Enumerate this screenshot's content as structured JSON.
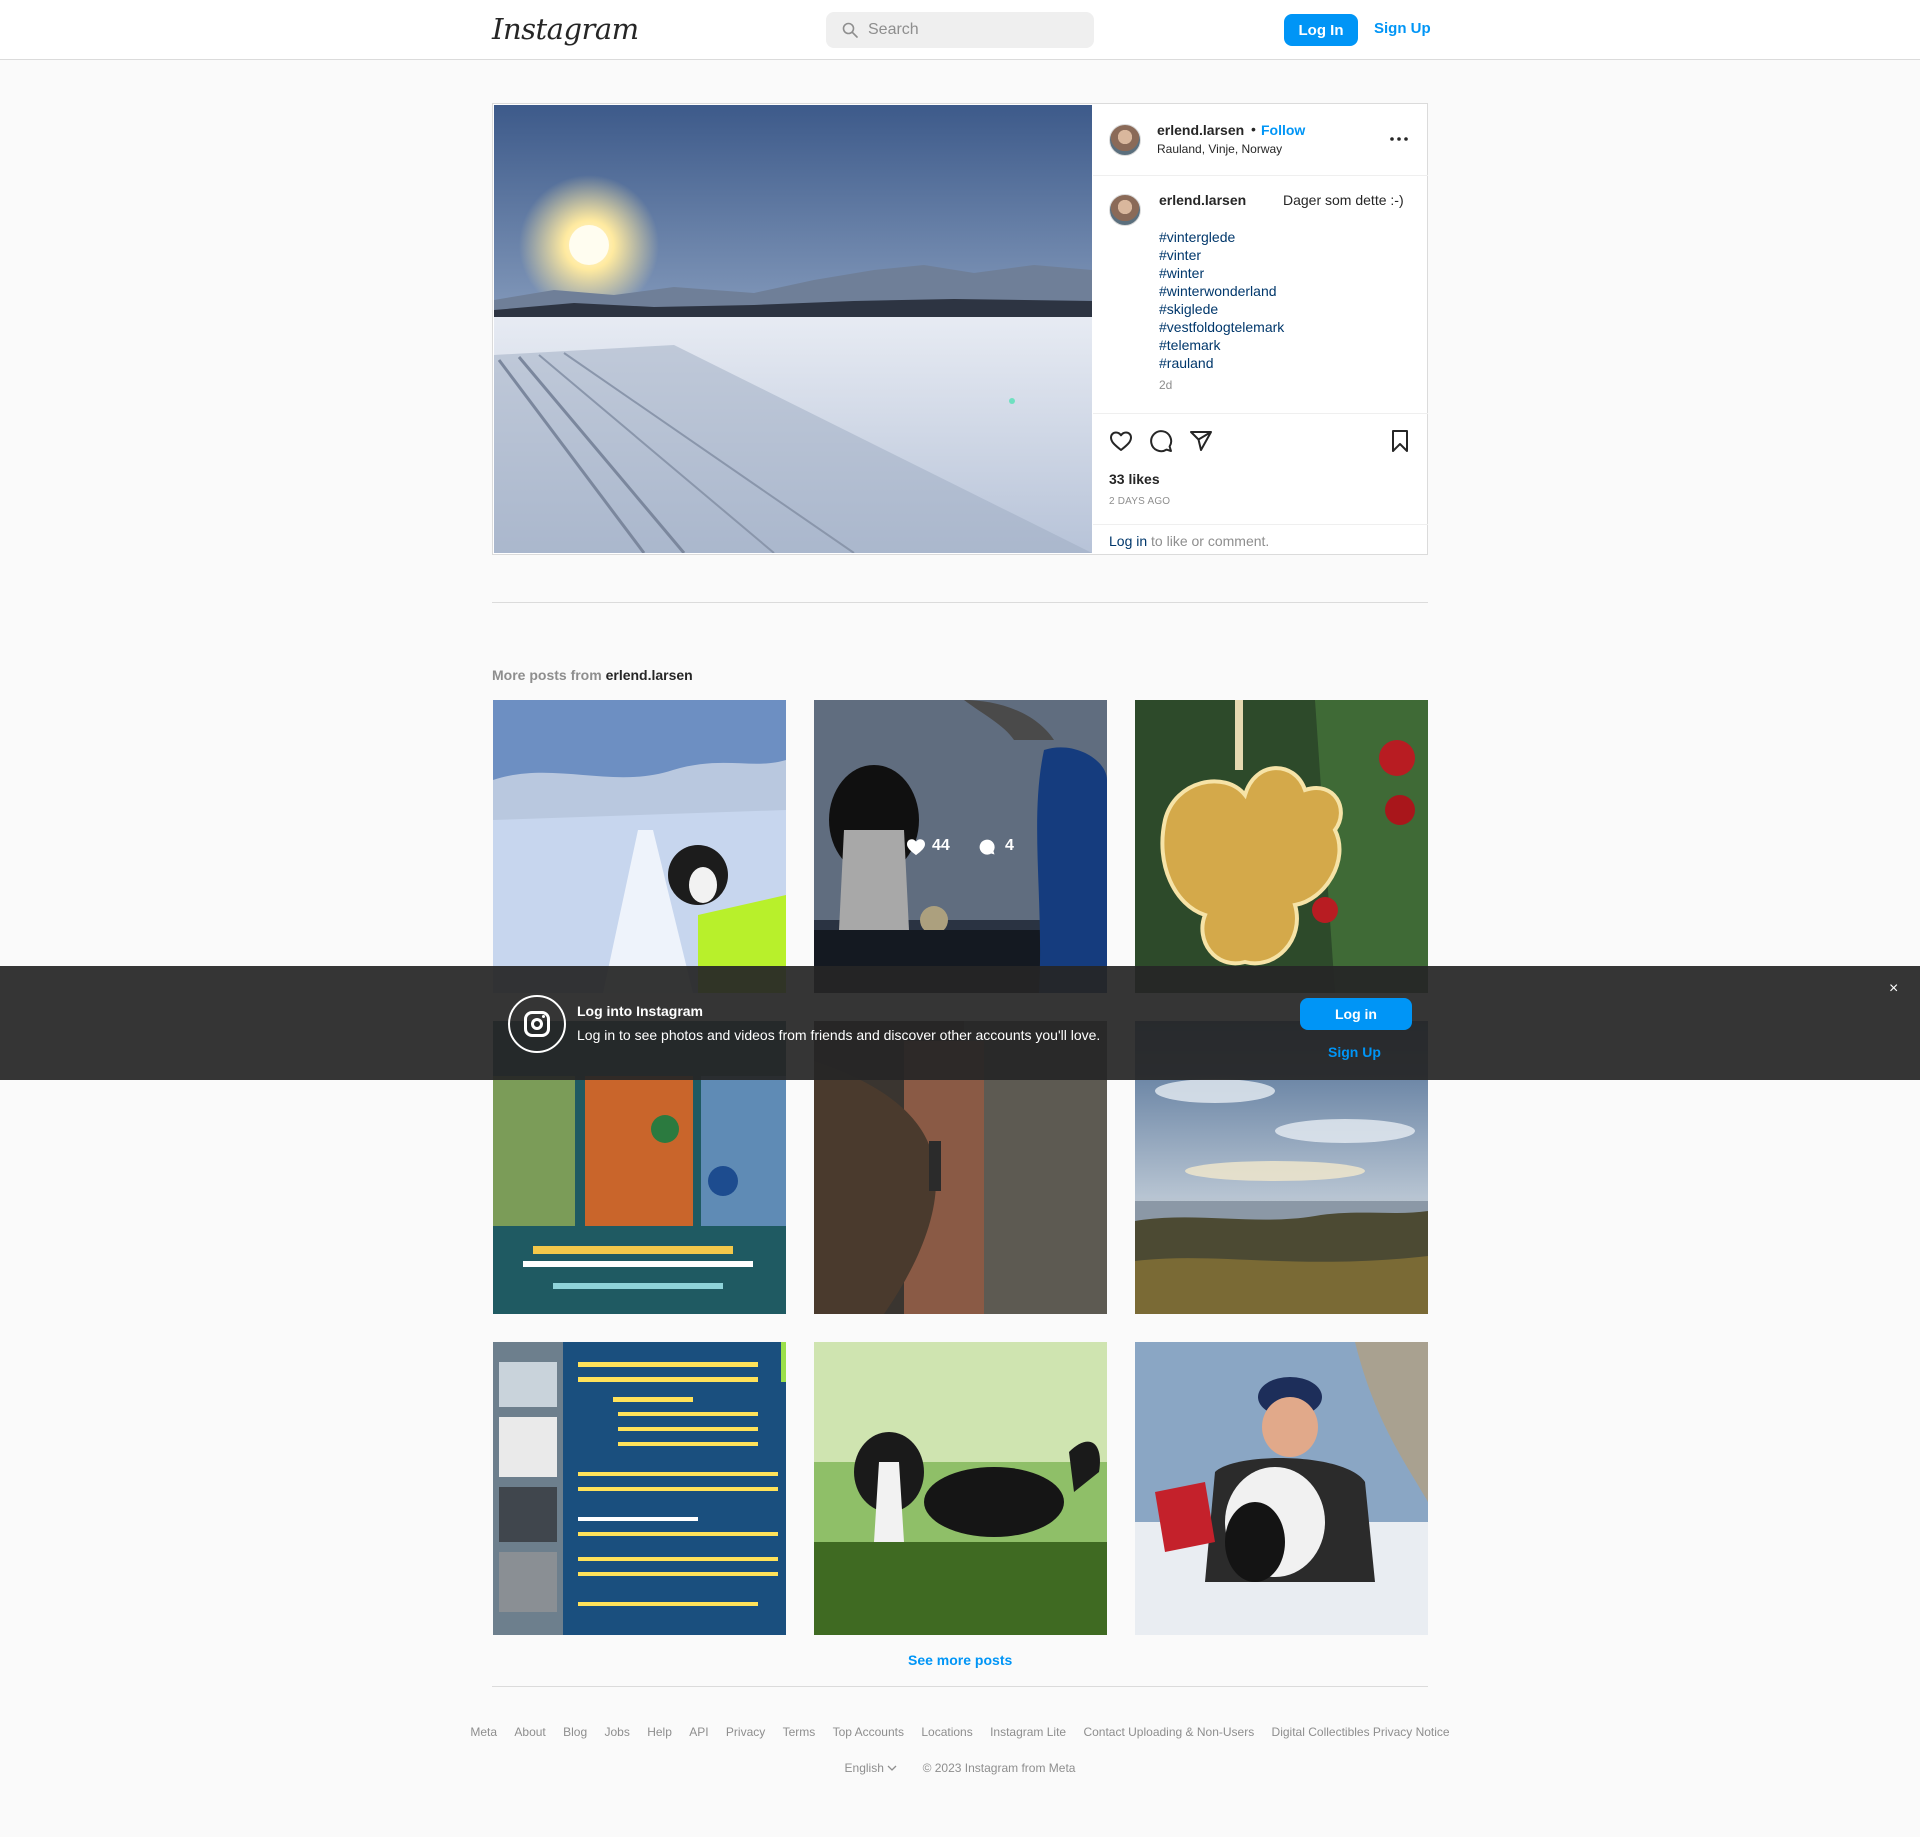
{
  "header": {
    "logo_text": "Instagram",
    "search_placeholder": "Search",
    "login_label": "Log In",
    "signup_label": "Sign Up"
  },
  "post": {
    "username": "erlend.larsen",
    "separator": "•",
    "follow_label": "Follow",
    "location": "Rauland, Vinje, Norway",
    "caption_text": "Dager som dette :-)",
    "hashtags": [
      "#vinterglede",
      "#vinter",
      "#winter",
      "#winterwonderland",
      "#skiglede",
      "#vestfoldogtelemark",
      "#telemark",
      "#rauland"
    ],
    "caption_time": "2d",
    "likes": "33 likes",
    "posted": "2 DAYS AGO",
    "login_link": "Log in",
    "login_suffix": " to like or comment."
  },
  "more_posts": {
    "prefix": "More posts from ",
    "username": "erlend.larsen",
    "hover_likes": "44",
    "hover_comments": "4",
    "see_more_label": "See more posts"
  },
  "footer": {
    "links": [
      "Meta",
      "About",
      "Blog",
      "Jobs",
      "Help",
      "API",
      "Privacy",
      "Terms",
      "Top Accounts",
      "Locations",
      "Instagram Lite",
      "Contact Uploading & Non-Users",
      "Digital Collectibles Privacy Notice"
    ],
    "language": "English",
    "copyright": "© 2023 Instagram from Meta"
  },
  "banner": {
    "title": "Log into Instagram",
    "text": "Log in to see photos and videos from friends and discover other accounts you'll love.",
    "login_label": "Log in",
    "signup_label": "Sign Up",
    "close_label": "×"
  },
  "colors": {
    "accent": "#0095f6",
    "link_dark": "#00376b",
    "text": "#262626",
    "muted": "#8e8e8e"
  }
}
